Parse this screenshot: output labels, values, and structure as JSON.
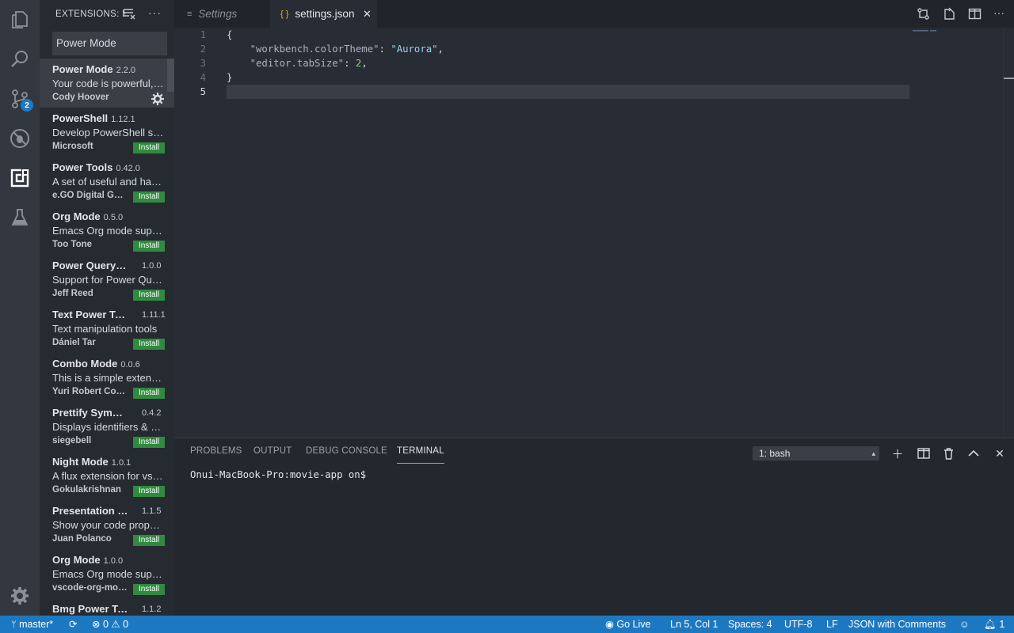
{
  "activity_bar": {
    "items": [
      {
        "icon": "files-icon"
      },
      {
        "icon": "search-icon"
      },
      {
        "icon": "source-control-icon",
        "badge": "2"
      },
      {
        "icon": "debug-icon"
      },
      {
        "icon": "extensions-icon"
      },
      {
        "icon": "test-flask-icon"
      }
    ],
    "bottom_icon": "manage-gear-icon"
  },
  "sidebar": {
    "title": "EXTENSIONS: MARKETPLACE",
    "search_value": "Power Mode",
    "install_label": "Install",
    "extensions": [
      {
        "name": "Power Mode",
        "version": "2.2.0",
        "description": "Your code is powerful, unleash it!",
        "publisher": "Cody Hoover",
        "installed": true
      },
      {
        "name": "PowerShell",
        "version": "1.12.1",
        "description": "Develop PowerShell scripts in Visual Studio Code!",
        "publisher": "Microsoft",
        "installed": false
      },
      {
        "name": "Power Tools",
        "version": "0.42.0",
        "description": "A set of useful and handy tools for Visual Studio Code.",
        "publisher": "e.GO Digital GmbH",
        "installed": false
      },
      {
        "name": "Org Mode",
        "version": "0.5.0",
        "description": "Emacs Org mode support for VSCode",
        "publisher": "Too Tone",
        "installed": false
      },
      {
        "name": "Power Query / M Language",
        "version": "1.0.0",
        "description": "Support for Power Query",
        "publisher": "Jeff Reed",
        "installed": false
      },
      {
        "name": "Text Power Tools",
        "version": "1.11.1",
        "description": "Text manipulation tools",
        "publisher": "Dániel Tar",
        "installed": false
      },
      {
        "name": "Combo Mode",
        "version": "0.0.6",
        "description": "This is a simple extension",
        "publisher": "Yuri Robert Coelho",
        "installed": false
      },
      {
        "name": "Prettify Symbols Mode",
        "version": "0.4.2",
        "description": "Displays identifiers & operators as symbols",
        "publisher": "siegebell",
        "installed": false
      },
      {
        "name": "Night Mode",
        "version": "1.0.1",
        "description": "A flux extension for vscode",
        "publisher": "Gokulakrishnan",
        "installed": false
      },
      {
        "name": "Presentation Mode",
        "version": "1.1.5",
        "description": "Show your code properly",
        "publisher": "Juan Polanco",
        "installed": false
      },
      {
        "name": "Org Mode",
        "version": "1.0.0",
        "description": "Emacs Org mode support",
        "publisher": "vscode-org-mode",
        "installed": false
      },
      {
        "name": "Bmg Power Tools",
        "version": "1.1.2",
        "description": "",
        "publisher": "",
        "installed": false
      }
    ]
  },
  "tabs": [
    {
      "label": "Settings",
      "icon": "list-icon",
      "active": false
    },
    {
      "label": "settings.json",
      "icon": "json-braces-icon",
      "active": true
    }
  ],
  "editor": {
    "lines": [
      {
        "num": "1",
        "text": "{"
      },
      {
        "num": "2",
        "key": "\"workbench.colorTheme\"",
        "value": "\"Aurora\""
      },
      {
        "num": "3",
        "key": "\"editor.tabSize\"",
        "value": "2"
      },
      {
        "num": "4",
        "text": "}"
      },
      {
        "num": "5",
        "text": ""
      }
    ]
  },
  "panel": {
    "tabs": [
      "PROBLEMS",
      "OUTPUT",
      "DEBUG CONSOLE",
      "TERMINAL"
    ],
    "active_tab": "TERMINAL",
    "terminal_select": "1: bash",
    "terminal_text": "Onui-MacBook-Pro:movie-app on$"
  },
  "status_bar": {
    "branch": "master*",
    "errors": "0",
    "warnings": "0",
    "go_live": "Go Live",
    "position": "Ln 5, Col 1",
    "spaces": "Spaces: 4",
    "encoding": "UTF-8",
    "eol": "LF",
    "language": "JSON with Comments",
    "notifications": "1"
  },
  "colors": {
    "statusbar": "#1c78c0",
    "install_button": "#318a3f",
    "badge": "#1e79c4",
    "string": "#9ad1ee",
    "number": "#8ccf7e"
  }
}
